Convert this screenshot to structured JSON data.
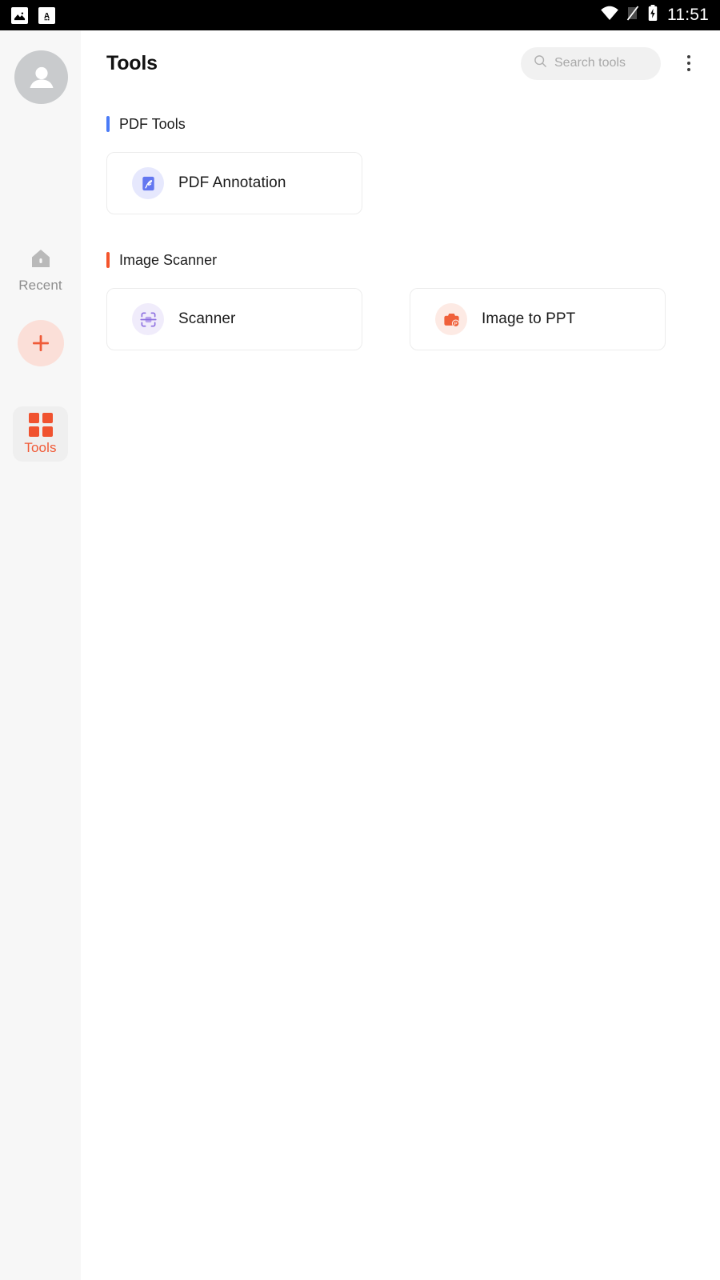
{
  "status_bar": {
    "notifications": [
      {
        "icon": "image-notification-icon"
      },
      {
        "icon": "letter-a-notification-icon"
      }
    ],
    "wifi_icon": "wifi-icon",
    "signal_icon": "no-signal-icon",
    "battery_icon": "battery-charging-icon",
    "time": "11:51",
    "background": "#000000"
  },
  "sidebar": {
    "avatar": {
      "icon": "person-avatar-icon"
    },
    "items": [
      {
        "key": "recent",
        "label": "Recent",
        "icon": "home-icon",
        "active": false
      },
      {
        "key": "add",
        "label": "",
        "icon": "plus-icon",
        "active": false
      },
      {
        "key": "tools",
        "label": "Tools",
        "icon": "grid-icon",
        "active": true
      }
    ],
    "active_color": "#f0522f",
    "inactive_color": "#8e8e8e",
    "background": "#f7f7f7"
  },
  "header": {
    "title": "Tools",
    "search": {
      "placeholder": "Search tools",
      "value": "",
      "icon": "search-icon"
    },
    "overflow_menu": {
      "icon": "more-vertical-icon"
    }
  },
  "main": {
    "sections": [
      {
        "title": "PDF Tools",
        "accent": "#4a7bf7",
        "cards": [
          {
            "label": "PDF Annotation",
            "icon": "pdf-annotation-icon",
            "icon_bg": "#e6e8fd",
            "icon_color": "#6377f0"
          }
        ]
      },
      {
        "title": "Image Scanner",
        "accent": "#f4542b",
        "cards": [
          {
            "label": "Scanner",
            "icon": "scan-frame-icon",
            "icon_bg": "#f0ecfb",
            "icon_color": "#8d6fe0"
          },
          {
            "label": "Image to PPT",
            "icon": "camera-ppt-icon",
            "icon_bg": "#fdeae4",
            "icon_color": "#f0603a"
          }
        ]
      }
    ]
  }
}
